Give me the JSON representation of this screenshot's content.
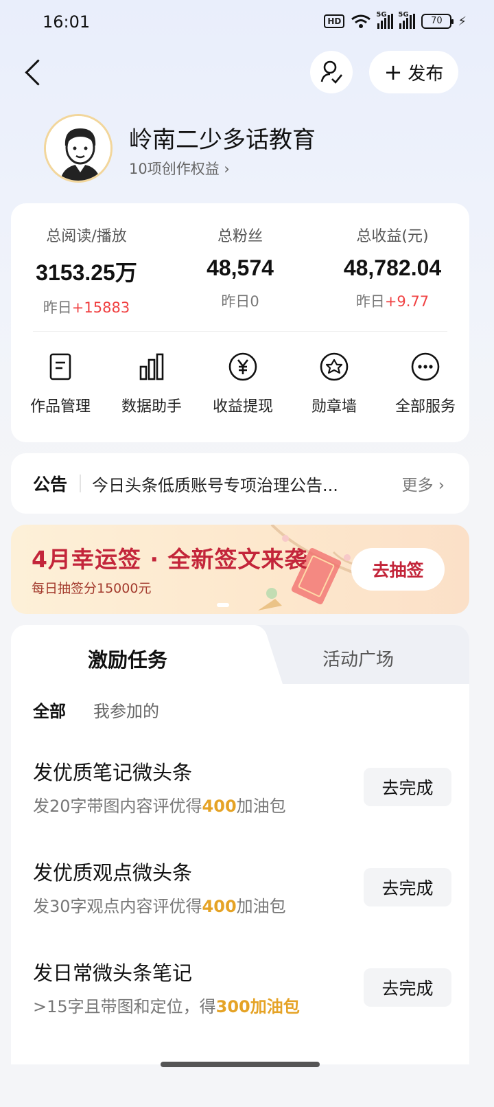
{
  "status_bar": {
    "time": "16:01",
    "hd": "HD",
    "sim1": "5G",
    "sim2": "5G",
    "battery": "70",
    "charging": "⚡"
  },
  "header": {
    "publish_label": "发布",
    "publish_plus": "+"
  },
  "profile": {
    "name": "岭南二少多话教育",
    "rights": "10项创作权益 ›"
  },
  "stats": [
    {
      "label": "总阅读/播放",
      "value": "3153.25万",
      "sub_prefix": "昨日",
      "sub_value": "+15883",
      "sub_up": true
    },
    {
      "label": "总粉丝",
      "value": "48,574",
      "sub_prefix": "昨日",
      "sub_value": "0",
      "sub_up": false
    },
    {
      "label": "总收益(元)",
      "value": "48,782.04",
      "sub_prefix": "昨日",
      "sub_value": "+9.77",
      "sub_up": true
    }
  ],
  "services": [
    {
      "label": "作品管理",
      "icon": "document-icon"
    },
    {
      "label": "数据助手",
      "icon": "bar-chart-icon"
    },
    {
      "label": "收益提现",
      "icon": "yen-icon"
    },
    {
      "label": "勋章墙",
      "icon": "medal-icon"
    },
    {
      "label": "全部服务",
      "icon": "more-icon"
    }
  ],
  "notice": {
    "title": "公告",
    "text": "今日头条低质账号专项治理公告...",
    "more": "更多 ›"
  },
  "banner": {
    "title": "4月幸运签 · 全新签文来袭",
    "subtitle": "每日抽签分15000元",
    "button": "去抽签"
  },
  "tabs": {
    "active": "激励任务",
    "inactive": "活动广场"
  },
  "filters": {
    "all": "全部",
    "joined": "我参加的"
  },
  "tasks": [
    {
      "title": "发优质笔记微头条",
      "desc_before": "发20字带图内容评优得",
      "desc_highlight": "400",
      "desc_after": "加油包",
      "button": "去完成"
    },
    {
      "title": "发优质观点微头条",
      "desc_before": "发30字观点内容评优得",
      "desc_highlight": "400",
      "desc_after": "加油包",
      "button": "去完成"
    },
    {
      "title": "发日常微头条笔记",
      "desc_before": ">15字且带图和定位，得",
      "desc_highlight": "300加油包",
      "desc_after": "",
      "button": "去完成"
    }
  ],
  "colors": {
    "accent_red": "#f04142",
    "banner_red": "#c3253a",
    "gold": "#e5a326"
  }
}
